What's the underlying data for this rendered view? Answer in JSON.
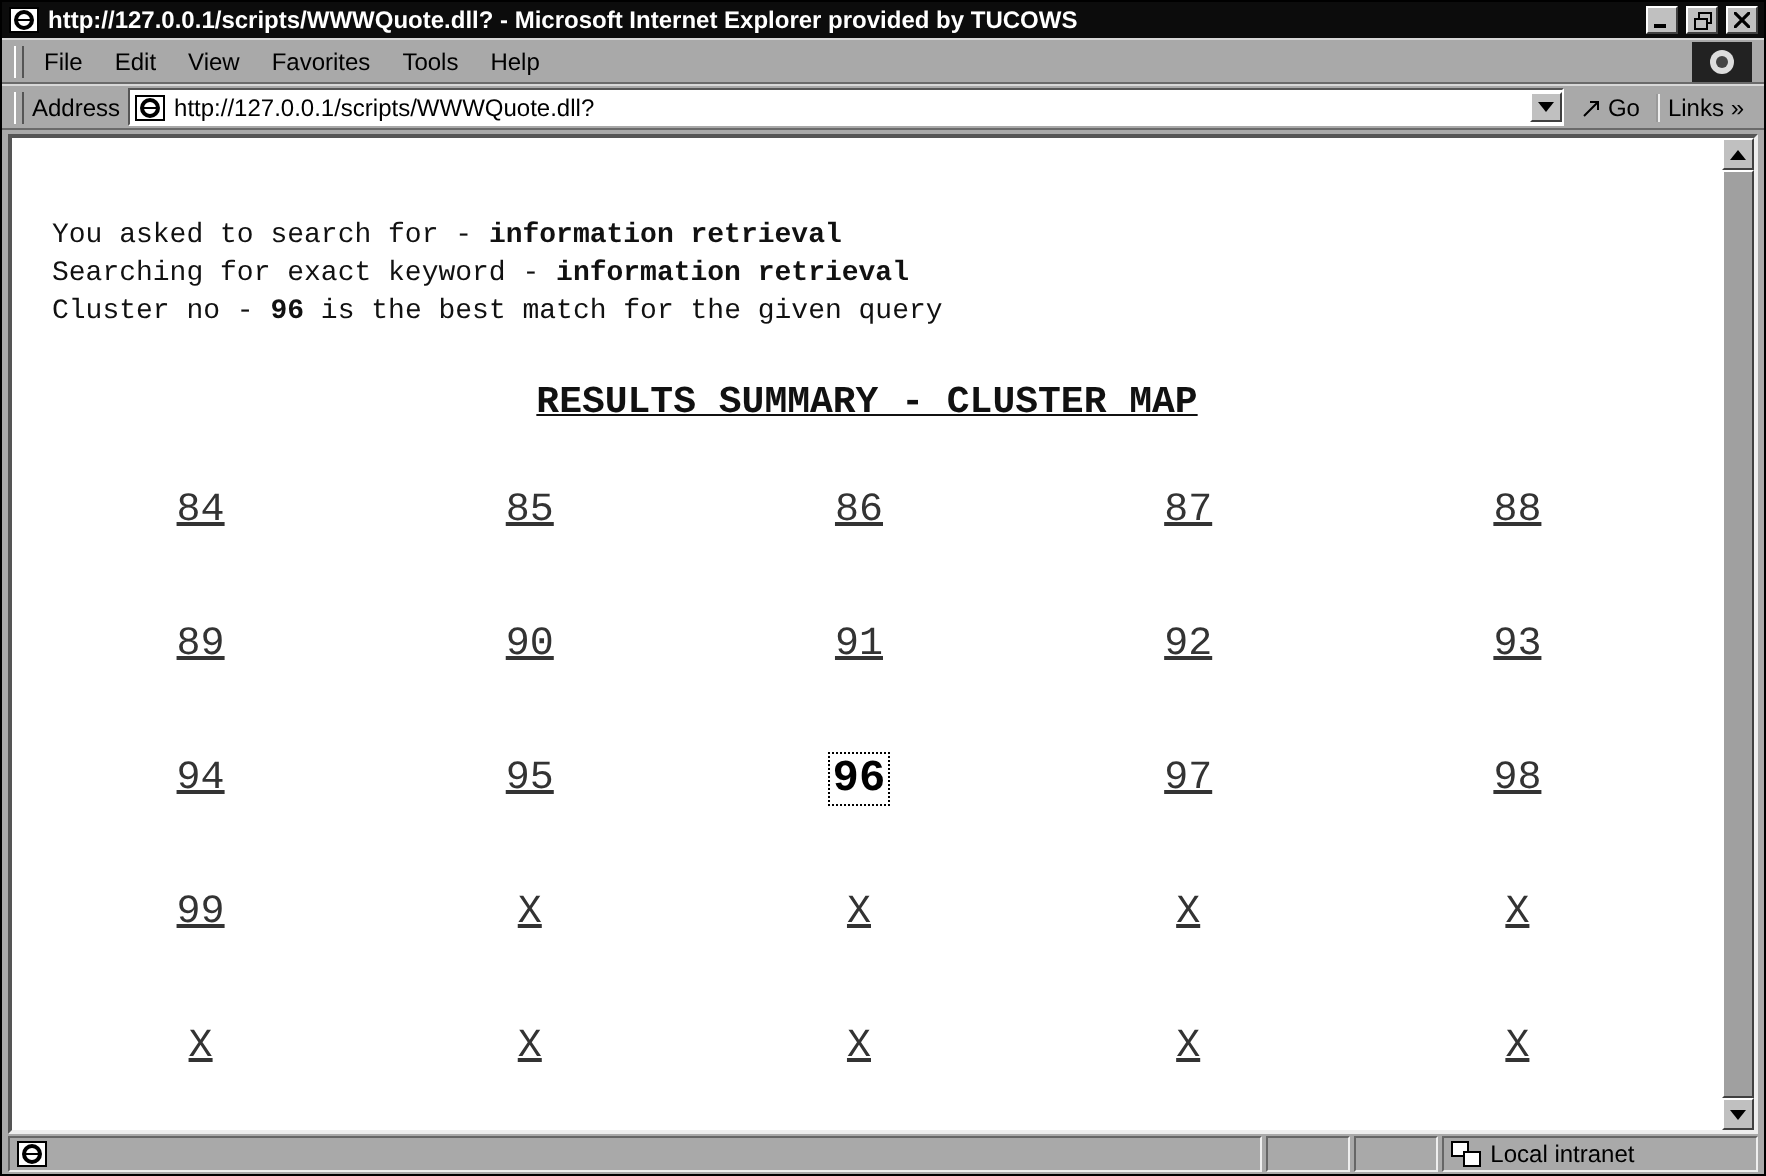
{
  "window": {
    "title": "http://127.0.0.1/scripts/WWWQuote.dll? - Microsoft Internet Explorer provided by TUCOWS"
  },
  "menu": [
    "File",
    "Edit",
    "View",
    "Favorites",
    "Tools",
    "Help"
  ],
  "address_bar": {
    "label": "Address",
    "value": "http://127.0.0.1/scripts/WWWQuote.dll?",
    "go": "Go",
    "links": "Links »"
  },
  "page": {
    "lines": [
      "You asked to search for - **information retrieval**",
      "Searching for exact keyword - **information retrieval**",
      "Cluster no - **96** is the best match for the given query"
    ],
    "heading": "RESULTS SUMMARY - CLUSTER MAP",
    "clusters": [
      [
        {
          "label": "84",
          "selected": false
        },
        {
          "label": "85",
          "selected": false
        },
        {
          "label": "86",
          "selected": false
        },
        {
          "label": "87",
          "selected": false
        },
        {
          "label": "88",
          "selected": false
        }
      ],
      [
        {
          "label": "89",
          "selected": false
        },
        {
          "label": "90",
          "selected": false
        },
        {
          "label": "91",
          "selected": false
        },
        {
          "label": "92",
          "selected": false
        },
        {
          "label": "93",
          "selected": false
        }
      ],
      [
        {
          "label": "94",
          "selected": false
        },
        {
          "label": "95",
          "selected": false
        },
        {
          "label": "96",
          "selected": true
        },
        {
          "label": "97",
          "selected": false
        },
        {
          "label": "98",
          "selected": false
        }
      ],
      [
        {
          "label": "99",
          "selected": false
        },
        {
          "label": "X",
          "selected": false
        },
        {
          "label": "X",
          "selected": false
        },
        {
          "label": "X",
          "selected": false
        },
        {
          "label": "X",
          "selected": false
        }
      ],
      [
        {
          "label": "X",
          "selected": false
        },
        {
          "label": "X",
          "selected": false
        },
        {
          "label": "X",
          "selected": false
        },
        {
          "label": "X",
          "selected": false
        },
        {
          "label": "X",
          "selected": false
        }
      ]
    ]
  },
  "status_bar": {
    "zone": "Local intranet"
  }
}
